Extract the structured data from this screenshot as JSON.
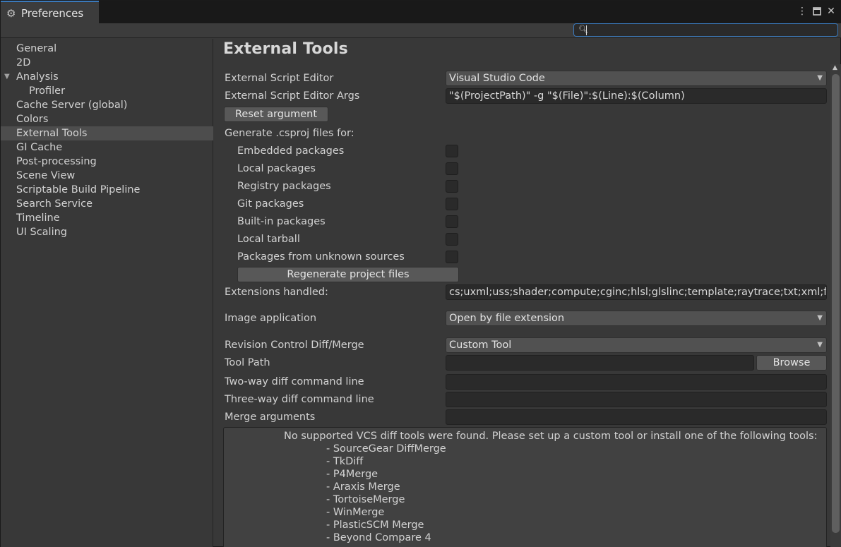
{
  "window": {
    "title": "Preferences",
    "icon": "gear-icon",
    "controls": {
      "menu": "⋮",
      "maximize": "🗖",
      "close": "✕"
    }
  },
  "search": {
    "value": "",
    "placeholder": ""
  },
  "sidebar": {
    "items": [
      {
        "label": "General"
      },
      {
        "label": "2D"
      },
      {
        "label": "Analysis",
        "foldout": "▼"
      },
      {
        "label": "Profiler"
      },
      {
        "label": "Cache Server (global)"
      },
      {
        "label": "Colors"
      },
      {
        "label": "External Tools",
        "selected": true
      },
      {
        "label": "GI Cache"
      },
      {
        "label": "Post-processing"
      },
      {
        "label": "Scene View"
      },
      {
        "label": "Scriptable Build Pipeline"
      },
      {
        "label": "Search Service"
      },
      {
        "label": "Timeline"
      },
      {
        "label": "UI Scaling"
      }
    ]
  },
  "main": {
    "title": "External Tools",
    "script_editor": {
      "label": "External Script Editor",
      "value": "Visual Studio Code"
    },
    "script_editor_args": {
      "label": "External Script Editor Args",
      "value": "\"$(ProjectPath)\" -g \"$(File)\":$(Line):$(Column)"
    },
    "reset_button": "Reset argument",
    "csproj_heading": "Generate .csproj files for:",
    "csproj_options": [
      {
        "label": "Embedded packages",
        "checked": false
      },
      {
        "label": "Local packages",
        "checked": false
      },
      {
        "label": "Registry packages",
        "checked": false
      },
      {
        "label": "Git packages",
        "checked": false
      },
      {
        "label": "Built-in packages",
        "checked": false
      },
      {
        "label": "Local tarball",
        "checked": false
      },
      {
        "label": "Packages from unknown sources",
        "checked": false
      }
    ],
    "regenerate_button": "Regenerate project files",
    "extensions": {
      "label": "Extensions handled:",
      "value": "cs;uxml;uss;shader;compute;cginc;hlsl;glslinc;template;raytrace;txt;xml;fnt"
    },
    "image_app": {
      "label": "Image application",
      "value": "Open by file extension"
    },
    "revision_control": {
      "label": "Revision Control Diff/Merge",
      "value": "Custom Tool"
    },
    "tool_path": {
      "label": "Tool Path",
      "value": "",
      "browse_label": "Browse"
    },
    "two_way": {
      "label": "Two-way diff command line",
      "value": ""
    },
    "three_way": {
      "label": "Three-way diff command line",
      "value": ""
    },
    "merge_args": {
      "label": "Merge arguments",
      "value": ""
    },
    "help": {
      "message": "No supported VCS diff tools were found. Please set up a custom tool or install one of the following tools:",
      "tools": [
        "- SourceGear DiffMerge",
        "- TkDiff",
        "- P4Merge",
        "- Araxis Merge",
        "- TortoiseMerge",
        "- WinMerge",
        "- PlasticSCM Merge",
        "- Beyond Compare 4"
      ]
    }
  },
  "colors": {
    "accent": "#3a79bb",
    "window_bg": "#383838",
    "field_bg": "#2a2a2a",
    "selection_bg": "#4d4d4d"
  }
}
